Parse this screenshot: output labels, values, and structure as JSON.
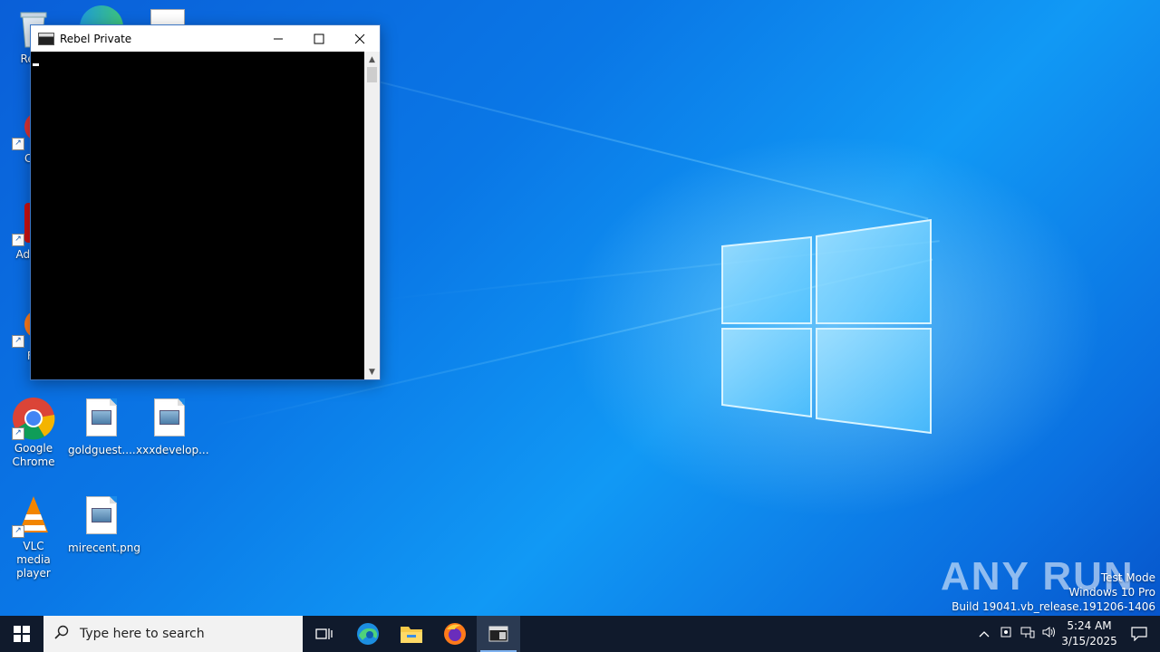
{
  "desktop": {
    "icons": [
      {
        "label": "Recy",
        "kind": "recycle-bin"
      },
      {
        "label": "CCl",
        "kind": "ccleaner"
      },
      {
        "label": "Ad Acr",
        "kind": "acrobat"
      },
      {
        "label": "Fir",
        "kind": "firefox"
      },
      {
        "label": "Google Chrome",
        "kind": "chrome"
      },
      {
        "label": "goldguest....",
        "kind": "image-file"
      },
      {
        "label": "xxxdevelop...",
        "kind": "image-file"
      },
      {
        "label": "VLC media player",
        "kind": "vlc"
      },
      {
        "label": "mirecent.png",
        "kind": "image-file"
      }
    ]
  },
  "console_window": {
    "title": "Rebel Private",
    "minimize_glyph": "—",
    "maximize_glyph": "☐",
    "close_glyph": "✕"
  },
  "taskbar": {
    "search_placeholder": "Type here to search",
    "apps": [
      "task-view",
      "edge",
      "file-explorer",
      "firefox",
      "console"
    ],
    "time": "5:24 AM",
    "date": "3/15/2025"
  },
  "watermark": {
    "brand": "ANY RUN",
    "line1": "Test Mode",
    "line2": "Windows 10 Pro",
    "line3": "Build 19041.vb_release.191206-1406"
  },
  "colors": {
    "desktop_blue": "#0a77e6",
    "taskbar": "#101a2c",
    "console_bg": "#000000"
  }
}
